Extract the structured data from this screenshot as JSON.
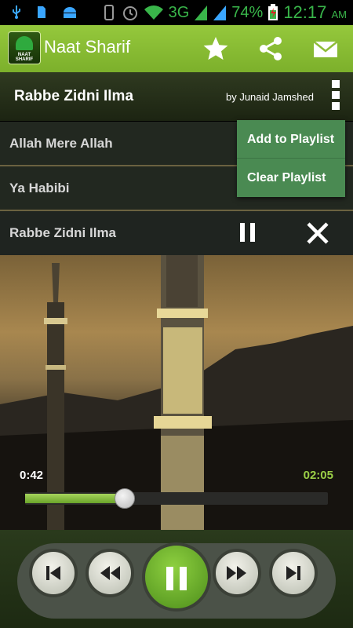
{
  "status_bar": {
    "network": "3G",
    "battery_percent": "74%",
    "time": "12:17",
    "ampm": "AM"
  },
  "app": {
    "title": "Naat Sharif",
    "logo_caption": "NAAT SHARIF",
    "accent_color": "#7cb02b"
  },
  "now_playing": {
    "title": "Rabbe Zidni Ilma",
    "artist": "by Junaid Jamshed"
  },
  "playlist": {
    "items": [
      {
        "label": "Allah Mere Allah"
      },
      {
        "label": "Ya Habibi"
      },
      {
        "label": "Rabbe Zidni Ilma"
      }
    ]
  },
  "menu": {
    "items": [
      {
        "label": "Add to Playlist"
      },
      {
        "label": "Clear Playlist"
      }
    ]
  },
  "player": {
    "elapsed": "0:42",
    "total": "02:05",
    "progress_fraction": 0.33
  },
  "icons": {
    "actionbar": [
      "star-icon",
      "share-icon",
      "mail-icon"
    ],
    "controls": [
      "skip-previous-icon",
      "rewind-icon",
      "pause-icon",
      "fast-forward-icon",
      "skip-next-icon"
    ]
  }
}
